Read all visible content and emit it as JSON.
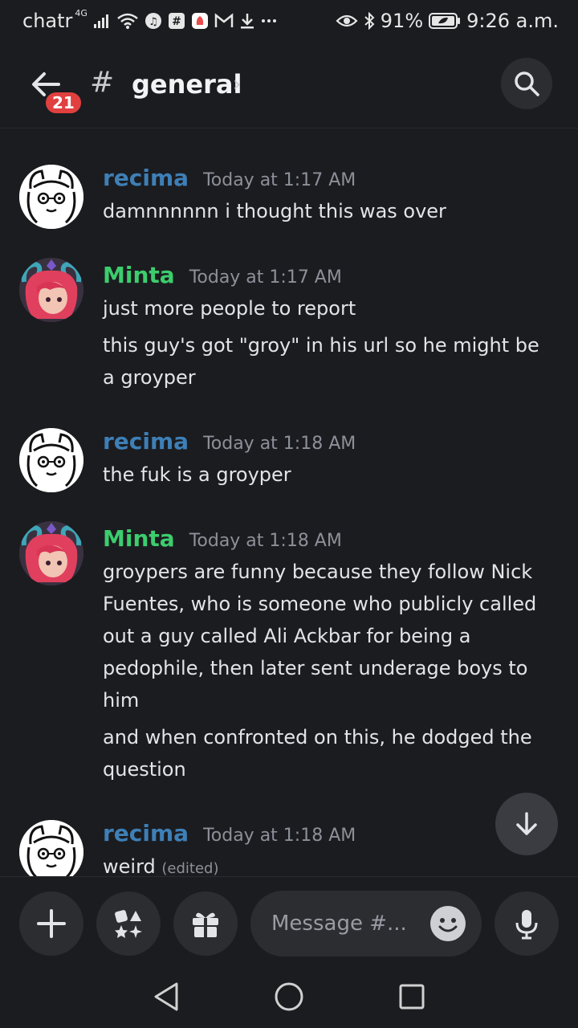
{
  "status_bar": {
    "carrier": "chatr",
    "network": "4G",
    "battery": "91%",
    "time": "9:26 a.m."
  },
  "header": {
    "unread_count": "21",
    "hash": "#",
    "channel": "general",
    "chevron": "›"
  },
  "messages": [
    {
      "author": "recima",
      "author_color": "#3e7fb6",
      "timestamp": "Today at 1:17 AM",
      "lines": [
        "damnnnnnn i thought this was over"
      ]
    },
    {
      "author": "Minta",
      "author_color": "#3ccd6d",
      "timestamp": "Today at 1:17 AM",
      "lines": [
        "just more people to report",
        "this guy's got \"groy\" in his url so he might be a groyper"
      ]
    },
    {
      "author": "recima",
      "author_color": "#3e7fb6",
      "timestamp": "Today at 1:18 AM",
      "lines": [
        "the fuk is a groyper"
      ]
    },
    {
      "author": "Minta",
      "author_color": "#3ccd6d",
      "timestamp": "Today at 1:18 AM",
      "lines": [
        "groypers are funny because they follow Nick Fuentes, who is someone who publicly called out a guy called Ali Ackbar for being a pedophile, then later sent underage boys to him",
        "and when confronted on this, he dodged the question"
      ]
    },
    {
      "author": "recima",
      "author_color": "#3e7fb6",
      "timestamp": "Today at 1:18 AM",
      "lines": [
        "weird"
      ],
      "edited": "(edited)"
    }
  ],
  "composer": {
    "placeholder": "Message #..."
  },
  "icons": {
    "back": "arrow-left-icon",
    "search": "search-icon",
    "scroll_down": "arrow-down-icon",
    "add": "plus-icon",
    "apps": "apps-icon",
    "gift": "gift-icon",
    "emoji": "emoji-icon",
    "mic": "microphone-icon"
  }
}
